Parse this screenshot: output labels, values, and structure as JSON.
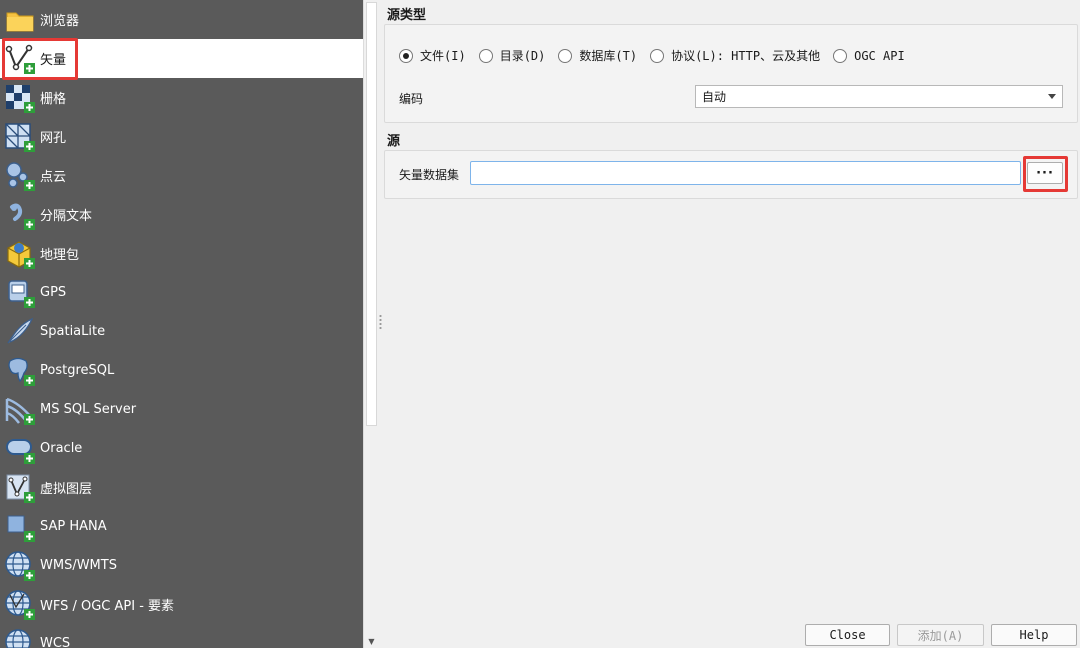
{
  "sidebar": {
    "items": [
      {
        "label": "浏览器",
        "icon": "folder-icon"
      },
      {
        "label": "矢量",
        "icon": "vector-layer-icon",
        "active": true
      },
      {
        "label": "栅格",
        "icon": "raster-layer-icon"
      },
      {
        "label": "网孔",
        "icon": "mesh-layer-icon"
      },
      {
        "label": "点云",
        "icon": "point-cloud-icon"
      },
      {
        "label": "分隔文本",
        "icon": "delimited-text-icon"
      },
      {
        "label": "地理包",
        "icon": "geopackage-icon"
      },
      {
        "label": "GPS",
        "icon": "gps-icon"
      },
      {
        "label": "SpatiaLite",
        "icon": "spatialite-icon"
      },
      {
        "label": "PostgreSQL",
        "icon": "postgresql-icon"
      },
      {
        "label": "MS SQL Server",
        "icon": "mssql-icon"
      },
      {
        "label": "Oracle",
        "icon": "oracle-icon"
      },
      {
        "label": "虚拟图层",
        "icon": "virtual-layer-icon"
      },
      {
        "label": "SAP HANA",
        "icon": "sap-hana-icon"
      },
      {
        "label": "WMS/WMTS",
        "icon": "wms-globe-icon"
      },
      {
        "label": "WFS / OGC API - 要素",
        "icon": "wfs-globe-icon"
      },
      {
        "label": "WCS",
        "icon": "wcs-globe-icon"
      }
    ]
  },
  "source_type": {
    "title": "源类型",
    "options": [
      {
        "label": "文件(I)",
        "checked": true
      },
      {
        "label": "目录(D)",
        "checked": false
      },
      {
        "label": "数据库(T)",
        "checked": false
      },
      {
        "label": "协议(L): HTTP、云及其他",
        "checked": false
      },
      {
        "label": "OGC API",
        "checked": false
      }
    ],
    "encoding_label": "编码",
    "encoding_value": "自动"
  },
  "source": {
    "title": "源",
    "dataset_label": "矢量数据集",
    "dataset_value": "",
    "browse_label": "···"
  },
  "footer": {
    "close_label": "Close",
    "add_label": "添加(A)",
    "help_label": "Help"
  },
  "colors": {
    "sidebar_bg": "#5a5a5a",
    "highlight": "#e53935",
    "input_focus": "#7eb4ea"
  }
}
